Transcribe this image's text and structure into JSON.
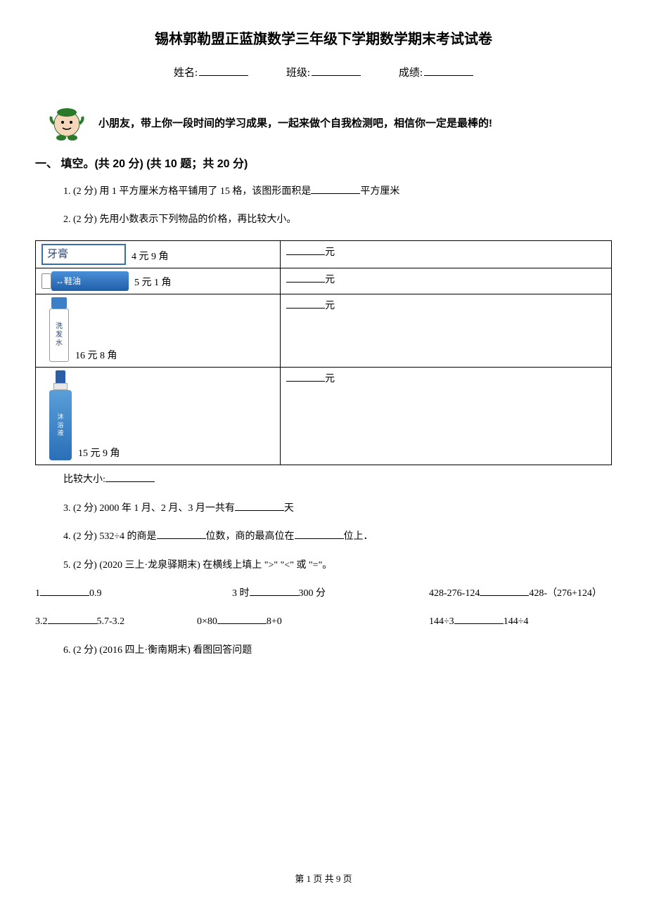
{
  "title": "锡林郭勒盟正蓝旗数学三年级下学期数学期末考试试卷",
  "info": {
    "name_label": "姓名:",
    "class_label": "班级:",
    "score_label": "成绩:"
  },
  "encouragement": "小朋友，带上你一段时间的学习成果，一起来做个自我检测吧，相信你一定是最棒的!",
  "section1": {
    "header": "一、 填空。(共 20 分)  (共 10 题；共 20 分)",
    "q1": {
      "prefix": "1.  (2 分)  用 1 平方厘米方格平铺用了 15 格，该图形面积是",
      "suffix": "平方厘米"
    },
    "q2": {
      "text": "2.  (2 分)  先用小数表示下列物品的价格，再比较大小。",
      "items": [
        {
          "label": "牙膏",
          "price": "4 元 9 角",
          "unit": "元"
        },
        {
          "label": "鞋油",
          "price": "5 元 1 角",
          "unit": "元"
        },
        {
          "label": "洗发水",
          "price": "16 元 8 角",
          "unit": "元"
        },
        {
          "label": "沐浴液",
          "price": "15 元 9 角",
          "unit": "元"
        }
      ],
      "compare_label": "比较大小:"
    },
    "q3": {
      "prefix": "3.  (2 分)  2000 年 1 月、2 月、3 月一共有",
      "suffix": "天"
    },
    "q4": {
      "prefix": "4.  (2 分)  532÷4 的商是",
      "mid": "位数，商的最高位在",
      "suffix": "位上．"
    },
    "q5": {
      "text": "5.  (2 分)  (2020 三上·龙泉驿期末)  在横线上填上 \">\" \"<\" 或 \"=\"。",
      "row1": [
        {
          "left": "1",
          "right": "0.9"
        },
        {
          "left": "3 时",
          "right": "300 分"
        },
        {
          "left": "428-276-124",
          "right": "428-（276+124）"
        }
      ],
      "row2": [
        {
          "left": "3.2",
          "right": "5.7-3.2"
        },
        {
          "left": "0×80",
          "right": "8+0"
        },
        {
          "left": "144÷3",
          "right": "144÷4"
        }
      ]
    },
    "q6": {
      "text": "6.  (2 分)  (2016 四上·衡南期末)  看图回答问题"
    }
  },
  "footer": "第 1 页 共 9 页"
}
